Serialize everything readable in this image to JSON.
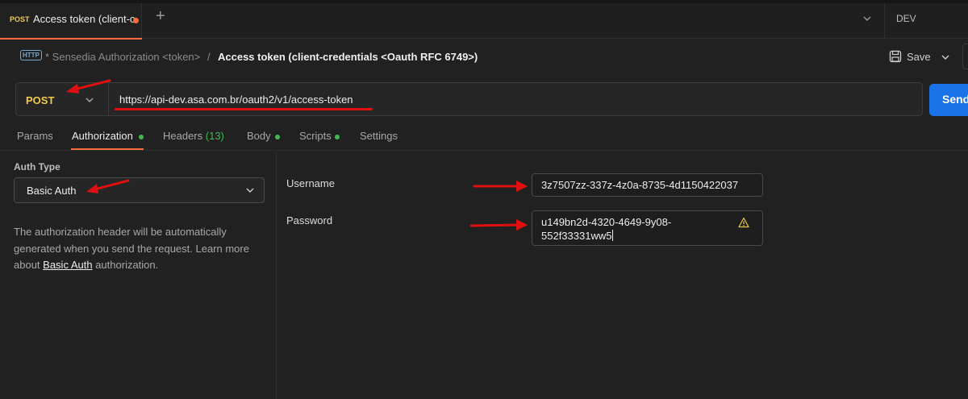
{
  "tabs": [
    {
      "method": "POST",
      "title": "Access token (client-c",
      "unsaved": true
    }
  ],
  "environment": "DEV",
  "breadcrumb": {
    "parent": "* Sensedia Authorization <token>",
    "separator": "/",
    "current": "Access token (client-credentials <Oauth RFC 6749>)",
    "icon_label": "HTTP"
  },
  "toolbar": {
    "save_label": "Save"
  },
  "request": {
    "method": "POST",
    "url": "https://api-dev.asa.com.br/oauth2/v1/access-token",
    "send_label": "Send"
  },
  "request_tabs": [
    {
      "label": "Params"
    },
    {
      "label": "Authorization",
      "dot": true,
      "active": true
    },
    {
      "label": "Headers",
      "count": "(13)"
    },
    {
      "label": "Body",
      "dot": true
    },
    {
      "label": "Scripts",
      "dot": true
    },
    {
      "label": "Settings"
    }
  ],
  "auth": {
    "type_label": "Auth Type",
    "type_value": "Basic Auth",
    "desc_before": "The authorization header will be automatically generated when you send the request. Learn more about ",
    "desc_link": "Basic Auth",
    "desc_after": " authorization.",
    "username_label": "Username",
    "username_value": "3z7507zz-337z-4z0a-8735-4d1150422037",
    "password_label": "Password",
    "password_line1": "u149bn2d-4320-4649-9y08-",
    "password_line2": "552f33331ww5"
  },
  "colors": {
    "accent": "#ff6c37",
    "method": "#f2c94c",
    "send": "#1a73e8",
    "status_dot": "#3fb950",
    "annotation": "#e01010"
  }
}
